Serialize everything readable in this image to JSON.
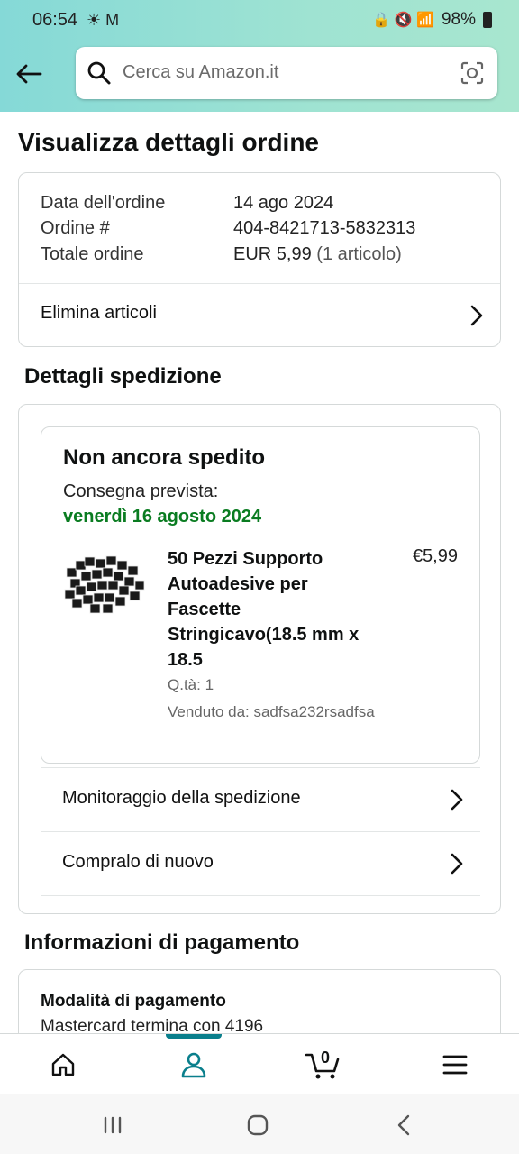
{
  "status_bar": {
    "time": "06:54",
    "battery": "98%"
  },
  "search": {
    "placeholder": "Cerca su Amazon.it"
  },
  "page": {
    "title": "Visualizza dettagli ordine"
  },
  "order": {
    "date_label": "Data dell'ordine",
    "date_value": "14 ago 2024",
    "number_label": "Ordine #",
    "number_value": "404-8421713-5832313",
    "total_label": "Totale ordine",
    "total_value": "EUR 5,99",
    "total_items": "(1 articolo)",
    "delete_items": "Elimina articoli"
  },
  "shipping": {
    "section_title": "Dettagli spedizione",
    "status": "Non ancora spedito",
    "eta_label": "Consegna prevista:",
    "eta_date": "venerdì 16 agosto 2024",
    "product": {
      "title": "50 Pezzi Supporto Autoadesive per Fascette Stringicavo(18.5 mm x 18.5",
      "price": "€5,99",
      "qty": "Q.tà: 1",
      "seller": "Venduto da: sadfsa232rsadfsa"
    },
    "track": "Monitoraggio della spedizione",
    "buy_again": "Compralo di nuovo"
  },
  "payment": {
    "section_title": "Informazioni di pagamento",
    "method_label": "Modalità di pagamento",
    "method_value": "Mastercard termina con 4196"
  },
  "bottom_nav": {
    "cart_count": "0"
  },
  "icons": [
    "back-arrow-icon",
    "search-icon",
    "camera-icon",
    "chevron-right-icon",
    "home-icon",
    "account-icon",
    "cart-icon",
    "menu-icon"
  ],
  "colors": {
    "accent": "#0a7f8c",
    "eta_green": "#0a7c21",
    "header": "#9fe3d2"
  }
}
